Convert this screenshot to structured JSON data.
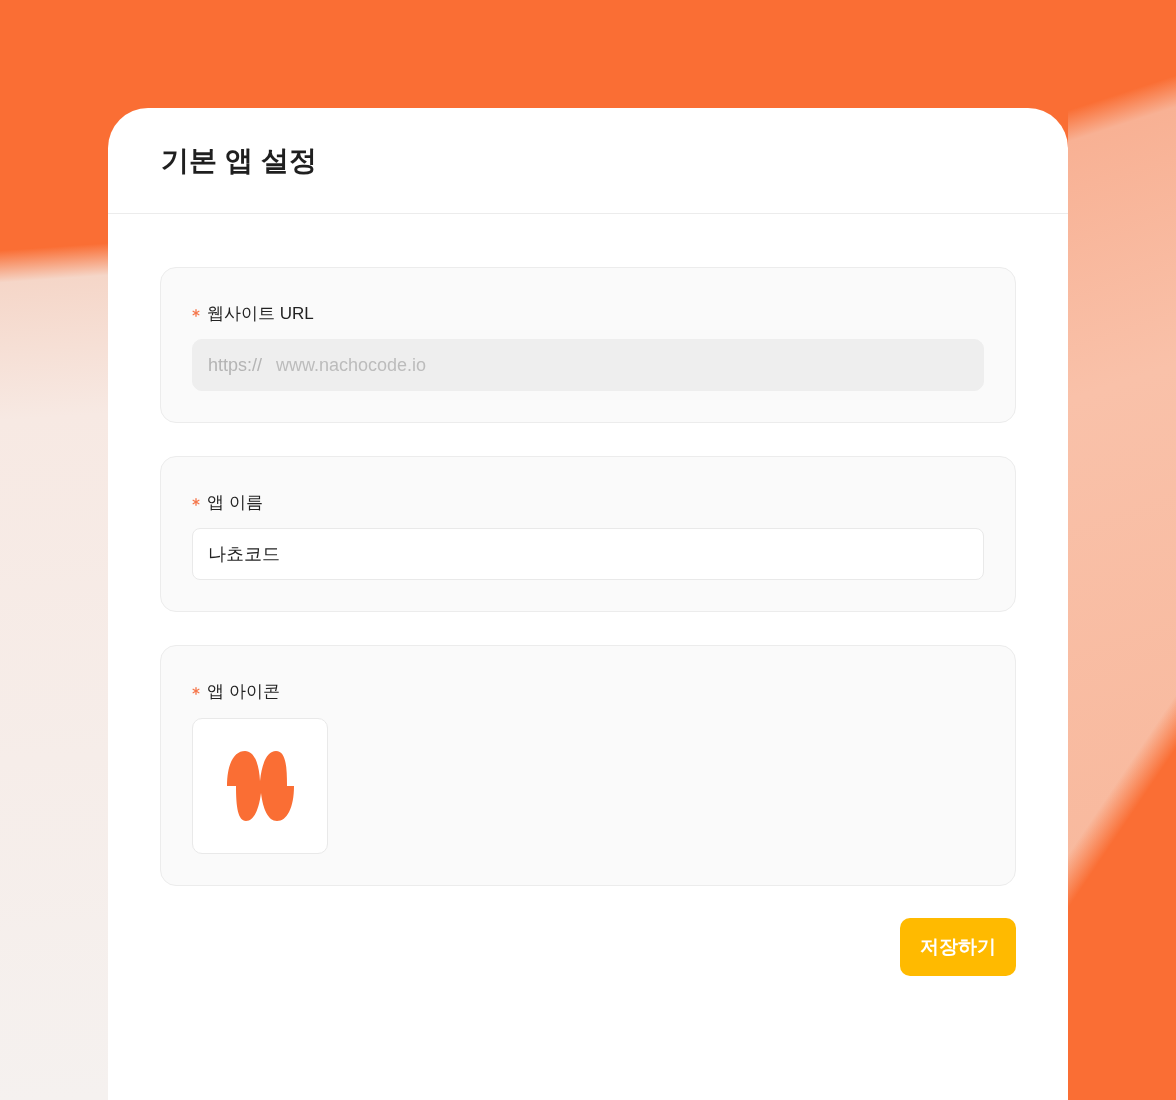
{
  "card": {
    "title": "기본 앱 설정"
  },
  "sections": [
    {
      "kind": "text",
      "label": "웹사이트 URL",
      "required": true,
      "prefix": "https://",
      "value": "www.nachocode.io",
      "disabled": true
    },
    {
      "kind": "text",
      "label": "앱 이름",
      "required": true,
      "value": "나쵸코드",
      "disabled": false
    },
    {
      "kind": "icon",
      "label": "앱 아이콘",
      "required": true
    }
  ],
  "save_button": {
    "label": "저장하기"
  }
}
